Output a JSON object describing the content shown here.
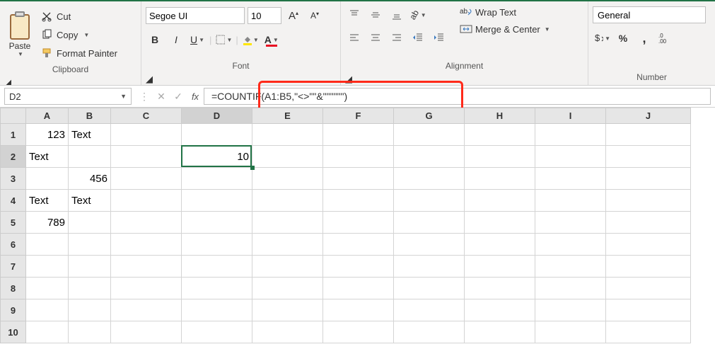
{
  "ribbon": {
    "clipboard": {
      "paste": "Paste",
      "cut": "Cut",
      "copy": "Copy",
      "format_painter": "Format Painter",
      "group_label": "Clipboard"
    },
    "font": {
      "font_name": "Segoe UI",
      "font_size": "10",
      "bold": "B",
      "italic": "I",
      "underline": "U",
      "group_label": "Font"
    },
    "alignment": {
      "wrap": "Wrap Text",
      "merge": "Merge & Center",
      "group_label": "Alignment"
    },
    "number": {
      "format": "General",
      "percent": "%",
      "comma": ",",
      "group_label": "Number"
    }
  },
  "formula_bar": {
    "name_box": "D2",
    "formula": "=COUNTIF(A1:B5,\"<>\"\"&\"\"\"\"\"\")"
  },
  "columns": [
    "A",
    "B",
    "C",
    "D",
    "E",
    "F",
    "G",
    "H",
    "I",
    "J"
  ],
  "rows": [
    "1",
    "2",
    "3",
    "4",
    "5",
    "6",
    "7",
    "8",
    "9",
    "10"
  ],
  "cells": {
    "A1": "123",
    "B1": "Text",
    "A2": "Text",
    "D2": "10",
    "B3": "456",
    "A4": "Text",
    "B4": "Text",
    "A5": "789"
  },
  "active_cell": "D2"
}
